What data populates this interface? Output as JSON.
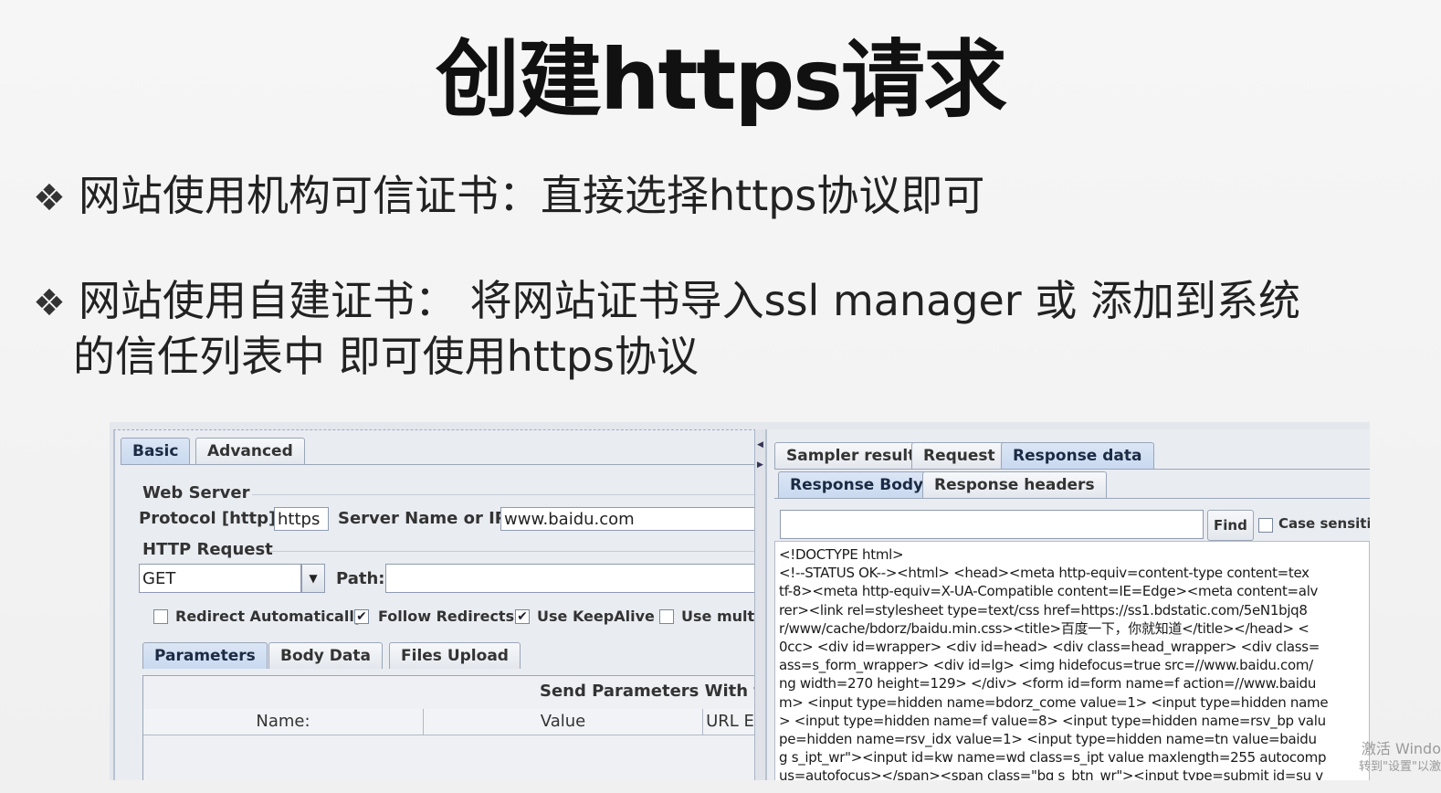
{
  "slide": {
    "title": "创建https请求",
    "bullets": [
      {
        "icon": "diamond-bullet-icon",
        "text": "网站使用机构可信证书：直接选择https协议即可"
      },
      {
        "icon": "diamond-bullet-icon",
        "line1": "网站使用自建证书： 将网站证书导入ssl manager 或 添加到系统",
        "line2": "的信任列表中 即可使用https协议"
      }
    ]
  },
  "left_panel": {
    "tabs": [
      "Basic",
      "Advanced"
    ],
    "web_server": {
      "group_label": "Web Server",
      "protocol_label": "Protocol [http]:",
      "protocol_value": "https",
      "server_label": "Server Name or IP:",
      "server_value": "www.baidu.com"
    },
    "http_request": {
      "group_label": "HTTP Request",
      "method_value": "GET",
      "path_label": "Path:",
      "path_value": ""
    },
    "checkboxes": [
      {
        "label": "Redirect Automatically",
        "checked": false
      },
      {
        "label": "Follow Redirects",
        "checked": true
      },
      {
        "label": "Use KeepAlive",
        "checked": true
      },
      {
        "label": "Use multip",
        "checked": false
      }
    ],
    "sub_tabs": [
      "Parameters",
      "Body Data",
      "Files Upload"
    ],
    "params_caption": "Send Parameters With the",
    "columns": [
      "Name:",
      "Value",
      "URL E"
    ]
  },
  "right_panel": {
    "tabs": [
      "Sampler result",
      "Request",
      "Response data"
    ],
    "sub_tabs": [
      "Response Body",
      "Response headers"
    ],
    "search_value": "",
    "find_label": "Find",
    "case_label": "Case sensitive",
    "response_lines": [
      "<!DOCTYPE html>",
      "<!--STATUS OK--><html> <head><meta http-equiv=content-type content=tex",
      "tf-8><meta http-equiv=X-UA-Compatible content=IE=Edge><meta content=alv",
      "rer><link rel=stylesheet type=text/css href=https://ss1.bdstatic.com/5eN1bjq8",
      "r/www/cache/bdorz/baidu.min.css><title>百度一下，你就知道</title></head> <",
      "0cc> <div id=wrapper> <div id=head> <div class=head_wrapper> <div class=",
      "ass=s_form_wrapper> <div id=lg> <img hidefocus=true src=//www.baidu.com/",
      "ng width=270 height=129> </div> <form id=form name=f action=//www.baidu",
      "m> <input type=hidden name=bdorz_come value=1> <input type=hidden name",
      "> <input type=hidden name=f value=8> <input type=hidden name=rsv_bp valu",
      "pe=hidden name=rsv_idx value=1> <input type=hidden name=tn value=baidu",
      "g s_ipt_wr\"><input id=kw name=wd class=s_ipt value maxlength=255 autocomp",
      "us=autofocus></span><span class=\"bg s_btn_wr\"><input type=submit id=su v"
    ]
  },
  "watermark": {
    "line1": "激活 Windo",
    "line2": "转到\"设置\"以激"
  }
}
